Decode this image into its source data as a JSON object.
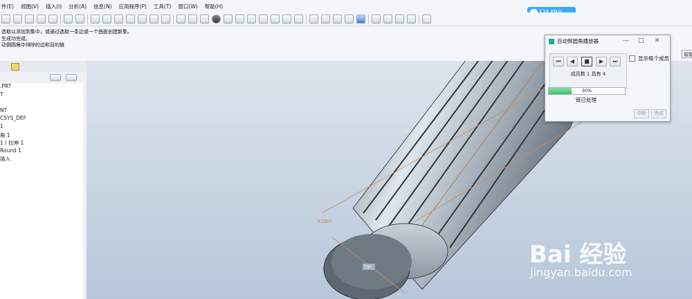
{
  "menu": [
    "件(E)",
    "视图(V)",
    "插入(I)",
    "分析(A)",
    "信息(N)",
    "应用程序(P)",
    "工具(T)",
    "窗口(W)",
    "帮助(H)"
  ],
  "messages": [
    "选取以添加到集中，或通过选取一条边或一个曲面创建新集。",
    "生成功完成。",
    "动倒圆角中排除的边和目的链"
  ],
  "upload_badge": "124 KB/s",
  "smart_button": "智能",
  "model_tree": {
    "items": [
      ".PRT",
      "T",
      "",
      "NT",
      "CSYS_DEF",
      "1",
      "角 1",
      "1 / 拉伸 1",
      "Round 1",
      "插入"
    ]
  },
  "dialog": {
    "title": "自动倒圆角播放器",
    "show_each_member": "显示每个成员",
    "member_count": "成员数 1 具有 4",
    "progress_percent": 30,
    "progress_label": "30%",
    "status": "链已处理",
    "interrupt_label": "中断",
    "finish_label": "完成"
  },
  "viewport": {
    "datum_label_1": "RIGHT",
    "datum_label_2": "TOP"
  },
  "watermark": {
    "logo": "Bai 经验",
    "url": "jingyan.baidu.com"
  }
}
